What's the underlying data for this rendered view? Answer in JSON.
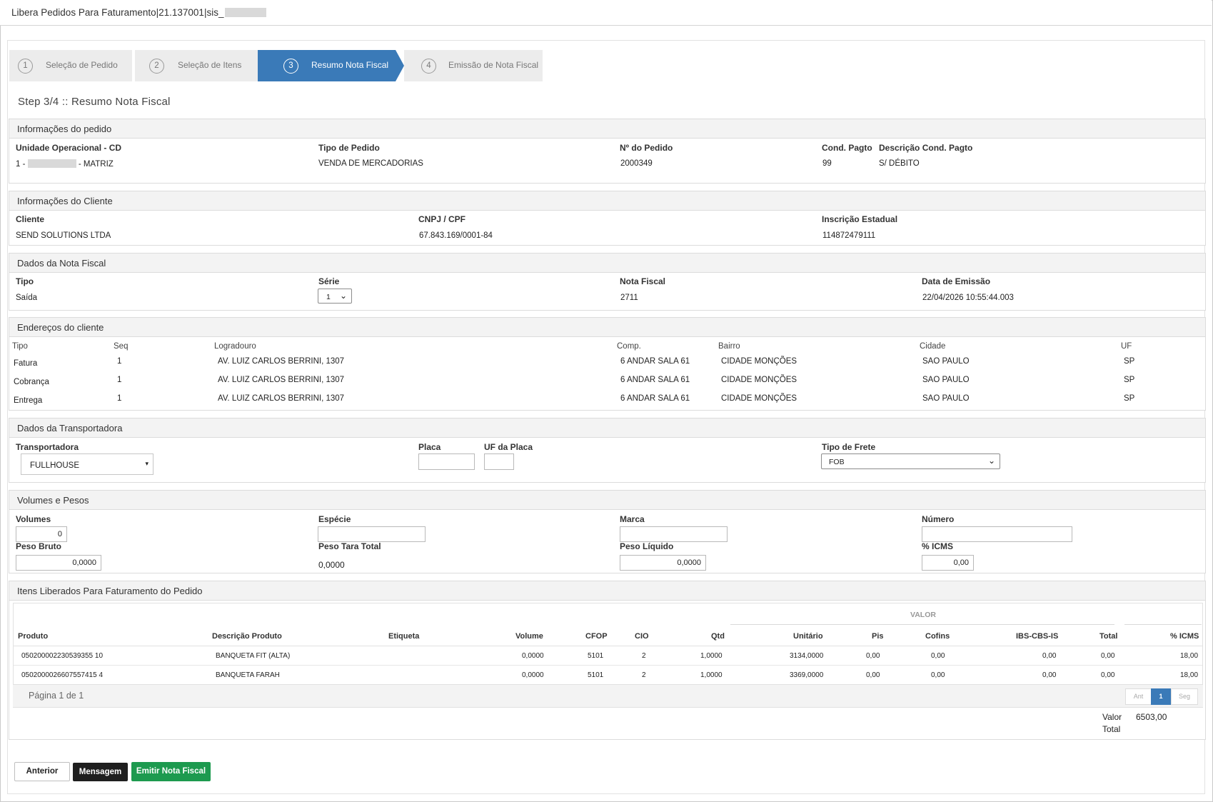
{
  "window": {
    "title": "Libera Pedidos Para Faturamento|21.137001|sis_"
  },
  "wizard": {
    "steps": [
      {
        "num": "1",
        "label": "Seleção de Pedido"
      },
      {
        "num": "2",
        "label": "Seleção de Itens"
      },
      {
        "num": "3",
        "label": "Resumo Nota Fiscal"
      },
      {
        "num": "4",
        "label": "Emissão de Nota Fiscal"
      }
    ]
  },
  "step_title": "Step 3/4 :: Resumo Nota Fiscal",
  "pedido": {
    "heading": "Informações do pedido",
    "unidade_label": "Unidade Operacional - CD",
    "unidade_prefix": "1 -",
    "unidade_suffix": "- MATRIZ",
    "tipo_label": "Tipo de Pedido",
    "tipo_value": "VENDA DE MERCADORIAS",
    "numero_label": "Nº do Pedido",
    "numero_value": "2000349",
    "cond_label": "Cond. Pagto",
    "cond_value": "99",
    "desc_cond_label": "Descrição Cond. Pagto",
    "desc_cond_value": "S/ DÉBITO"
  },
  "cliente": {
    "heading": "Informações do Cliente",
    "cliente_label": "Cliente",
    "cliente_value": "SEND SOLUTIONS LTDA",
    "cnpj_label": "CNPJ / CPF",
    "cnpj_value": "67.843.169/0001-84",
    "ie_label": "Inscrição Estadual",
    "ie_value": "114872479111"
  },
  "nota": {
    "heading": "Dados da Nota Fiscal",
    "tipo_label": "Tipo",
    "tipo_value": "Saída",
    "serie_label": "Série",
    "serie_value": "1",
    "nf_label": "Nota Fiscal",
    "nf_value": "2711",
    "data_label": "Data de Emissão",
    "data_value": "22/04/2026 10:55:44.003"
  },
  "enderecos": {
    "heading": "Endereços do cliente",
    "columns": [
      "Tipo",
      "Seq",
      "Logradouro",
      "Comp.",
      "Bairro",
      "Cidade",
      "UF"
    ],
    "rows": [
      {
        "tipo": "Fatura",
        "seq": "1",
        "logradouro": "AV. LUIZ CARLOS BERRINI, 1307",
        "comp": "6 ANDAR SALA 61",
        "bairro": "CIDADE MONÇÕES",
        "cidade": "SAO PAULO",
        "uf": "SP"
      },
      {
        "tipo": "Cobrança",
        "seq": "1",
        "logradouro": "AV. LUIZ CARLOS BERRINI, 1307",
        "comp": "6 ANDAR SALA 61",
        "bairro": "CIDADE MONÇÕES",
        "cidade": "SAO PAULO",
        "uf": "SP"
      },
      {
        "tipo": "Entrega",
        "seq": "1",
        "logradouro": "AV. LUIZ CARLOS BERRINI, 1307",
        "comp": "6 ANDAR SALA 61",
        "bairro": "CIDADE MONÇÕES",
        "cidade": "SAO PAULO",
        "uf": "SP"
      }
    ]
  },
  "transportadora": {
    "heading": "Dados da Transportadora",
    "transp_label": "Transportadora",
    "transp_value": "FULLHOUSE",
    "placa_label": "Placa",
    "placa_value": "",
    "uf_placa_label": "UF da Placa",
    "uf_placa_value": "",
    "frete_label": "Tipo de Frete",
    "frete_value": "FOB"
  },
  "volumes": {
    "heading": "Volumes e Pesos",
    "volumes_label": "Volumes",
    "volumes_value": "0",
    "especie_label": "Espécie",
    "especie_value": "",
    "marca_label": "Marca",
    "marca_value": "",
    "numero_label": "Número",
    "numero_value": "",
    "peso_bruto_label": "Peso Bruto",
    "peso_bruto_value": "0,0000",
    "peso_tara_label": "Peso Tara Total",
    "peso_tara_value": "0,0000",
    "peso_liquido_label": "Peso Líquido",
    "peso_liquido_value": "0,0000",
    "icms_label": "% ICMS",
    "icms_value": "0,00"
  },
  "itens": {
    "heading": "Itens Liberados Para Faturamento do Pedido",
    "group_label": "VALOR",
    "columns": [
      "Produto",
      "Descrição Produto",
      "Etiqueta",
      "Volume",
      "CFOP",
      "CIO",
      "Qtd",
      "Unitário",
      "Pis",
      "Cofins",
      "IBS-CBS-IS",
      "Total",
      "% ICMS"
    ],
    "rows": [
      {
        "produto": "050200002230539355 10",
        "descricao": "BANQUETA FIT (ALTA)",
        "etiqueta": "",
        "volume": "0,0000",
        "cfop": "5101",
        "cio": "2",
        "qtd": "1,0000",
        "unitario": "3134,0000",
        "pis": "0,00",
        "cofins": "0,00",
        "ibs": "0,00",
        "total": "0,00",
        "icms": "18,00"
      },
      {
        "produto": "0502000026607557415 4",
        "descricao": "BANQUETA FARAH",
        "etiqueta": "",
        "volume": "0,0000",
        "cfop": "5101",
        "cio": "2",
        "qtd": "1,0000",
        "unitario": "3369,0000",
        "pis": "0,00",
        "cofins": "0,00",
        "ibs": "0,00",
        "total": "0,00",
        "icms": "18,00"
      }
    ],
    "pagina": "Página 1 de 1",
    "pager": {
      "prev": "Ant",
      "current": "1",
      "next": "Seg"
    },
    "valor_total_label_1": "Valor",
    "valor_total_label_2": "Total",
    "valor_total_value": "6503,00"
  },
  "buttons": {
    "anterior": "Anterior",
    "mensagem": "Mensagem",
    "emitir": "Emitir Nota Fiscal"
  },
  "colors": {
    "accent": "#3a7ab8",
    "success": "#1d9a4f",
    "dark": "#1f1f1f"
  }
}
